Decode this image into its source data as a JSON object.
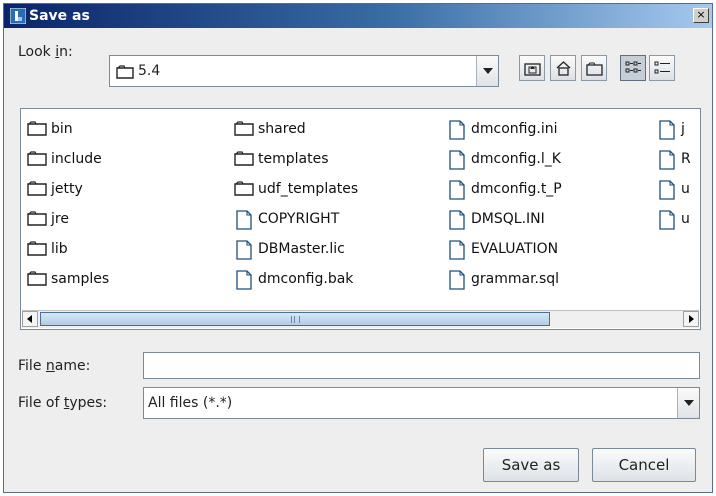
{
  "window": {
    "title": "Save as",
    "close_glyph": "×",
    "icon": "java-app-icon"
  },
  "look_in": {
    "label_pre": "Look ",
    "label_key": "i",
    "label_post": "n:",
    "value": "5.4",
    "icon": "folder-icon"
  },
  "toolbar": [
    {
      "name": "up-one-level-button",
      "icon": "folder-up-icon",
      "selected": false
    },
    {
      "name": "home-button",
      "icon": "home-icon",
      "selected": false
    },
    {
      "name": "new-folder-button",
      "icon": "new-folder-icon",
      "selected": false
    },
    {
      "name": "list-view-button",
      "icon": "list-view-icon",
      "selected": true
    },
    {
      "name": "details-view-button",
      "icon": "details-view-icon",
      "selected": false
    }
  ],
  "files": {
    "col1": [
      {
        "name": "bin",
        "type": "folder"
      },
      {
        "name": "include",
        "type": "folder"
      },
      {
        "name": "jetty",
        "type": "folder"
      },
      {
        "name": "jre",
        "type": "folder"
      },
      {
        "name": "lib",
        "type": "folder"
      },
      {
        "name": "samples",
        "type": "folder"
      }
    ],
    "col2": [
      {
        "name": "shared",
        "type": "folder"
      },
      {
        "name": "templates",
        "type": "folder"
      },
      {
        "name": "udf_templates",
        "type": "folder"
      },
      {
        "name": "COPYRIGHT",
        "type": "file"
      },
      {
        "name": "DBMaster.lic",
        "type": "file"
      },
      {
        "name": "dmconfig.bak",
        "type": "file"
      }
    ],
    "col3": [
      {
        "name": "dmconfig.ini",
        "type": "file"
      },
      {
        "name": "dmconfig.l_K",
        "type": "file"
      },
      {
        "name": "dmconfig.t_P",
        "type": "file"
      },
      {
        "name": "DMSQL.INI",
        "type": "file"
      },
      {
        "name": "EVALUATION",
        "type": "file"
      },
      {
        "name": "grammar.sql",
        "type": "file"
      }
    ],
    "col4": [
      {
        "name": "j",
        "type": "file"
      },
      {
        "name": "R",
        "type": "file"
      },
      {
        "name": "u",
        "type": "file"
      },
      {
        "name": "u",
        "type": "file"
      }
    ]
  },
  "scroll_position": 0.0,
  "file_name": {
    "label_pre": "File ",
    "label_key": "n",
    "label_post": "ame:",
    "value": ""
  },
  "file_type": {
    "label_pre": "File of ",
    "label_key": "t",
    "label_post": "ypes:",
    "value": "All files (*.*)"
  },
  "buttons": {
    "save": "Save as",
    "cancel": "Cancel"
  },
  "colors": {
    "title_start": "#0a246a",
    "title_end": "#a6caf0",
    "dialog_bg": "#eeeeee",
    "scroll_thumb": "#b3cbe4"
  }
}
